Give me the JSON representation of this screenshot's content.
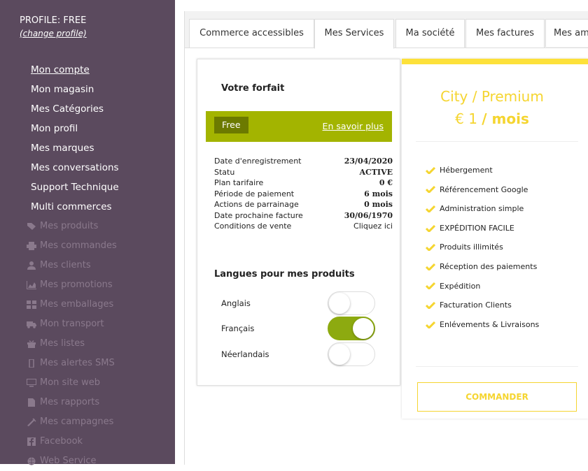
{
  "sidebar": {
    "profile_title": "PROFILE: FREE",
    "profile_link": "(change profile)",
    "main_items": [
      {
        "label": "Mon compte",
        "active": true
      },
      {
        "label": "Mon magasin"
      },
      {
        "label": "Mes Catégories"
      },
      {
        "label": "Mon profil"
      },
      {
        "label": "Mes marques"
      },
      {
        "label": "Mes conversations"
      },
      {
        "label": "Support Technique"
      },
      {
        "label": "Multi commerces"
      }
    ],
    "disabled_items": [
      {
        "label": "Mes produits",
        "icon": "tag-icon"
      },
      {
        "label": "Mes commandes",
        "icon": "printer-icon"
      },
      {
        "label": "Mes clients",
        "icon": "user-icon"
      },
      {
        "label": "Mes promotions",
        "icon": "area-chart-icon"
      },
      {
        "label": "Mes emballages",
        "icon": "grid-icon"
      },
      {
        "label": "Mon transport",
        "icon": "truck-icon"
      },
      {
        "label": "Mes listes",
        "icon": "gift-icon"
      },
      {
        "label": "Mes alertes SMS",
        "icon": "mobile-icon"
      },
      {
        "label": "Mon site web",
        "icon": "monitor-icon"
      },
      {
        "label": "Mes rapports",
        "icon": "file-icon"
      },
      {
        "label": "Mes campagnes",
        "icon": "megaphone-icon"
      },
      {
        "label": "Facebook",
        "icon": "facebook-icon"
      },
      {
        "label": "Web Service",
        "icon": "globe-icon"
      }
    ]
  },
  "tabs": [
    {
      "label": "Commerce accessibles"
    },
    {
      "label": "Mes Services",
      "active": true
    },
    {
      "label": "Ma société"
    },
    {
      "label": "Mes factures"
    },
    {
      "label": "Mes am"
    }
  ],
  "plan": {
    "title": "Votre forfait",
    "badge": "Free",
    "more_link": "En savoir plus",
    "rows": [
      {
        "label": "Date d'enregistrement",
        "value": "23/04/2020"
      },
      {
        "label": "Statu",
        "value": "ACTIVE"
      },
      {
        "label": "Plan tarifaire",
        "value": "0 €"
      },
      {
        "label": "Période de paiement",
        "value": "6 mois"
      },
      {
        "label": "Actions de parrainage",
        "value": "0 mois"
      },
      {
        "label": "Date prochaine facture",
        "value": "30/06/1970"
      },
      {
        "label": "Conditions de vente",
        "value": "Cliquez ici",
        "link": true
      }
    ],
    "languages_title": "Langues pour mes produits",
    "languages": [
      {
        "label": "Anglais",
        "enabled": false
      },
      {
        "label": "Français",
        "enabled": true
      },
      {
        "label": "Néerlandais",
        "enabled": false
      }
    ]
  },
  "offer": {
    "name": "City / Premium",
    "price_amount": "€ 1",
    "price_period": "/ mois",
    "features": [
      "Hébergement",
      "Référencement Google",
      "Administration simple",
      "EXPÉDITION FACILE",
      "Produits illimités",
      "Réception des paiements",
      "Expédition",
      "Facturation Clients",
      "Enlévements & Livraisons"
    ],
    "cta": "COMMANDER",
    "accent_color": "#f5d530"
  },
  "colors": {
    "sidebar_bg": "#5b4a5e",
    "plan_green": "#a3b400",
    "toggle_on": "#8daa10"
  }
}
